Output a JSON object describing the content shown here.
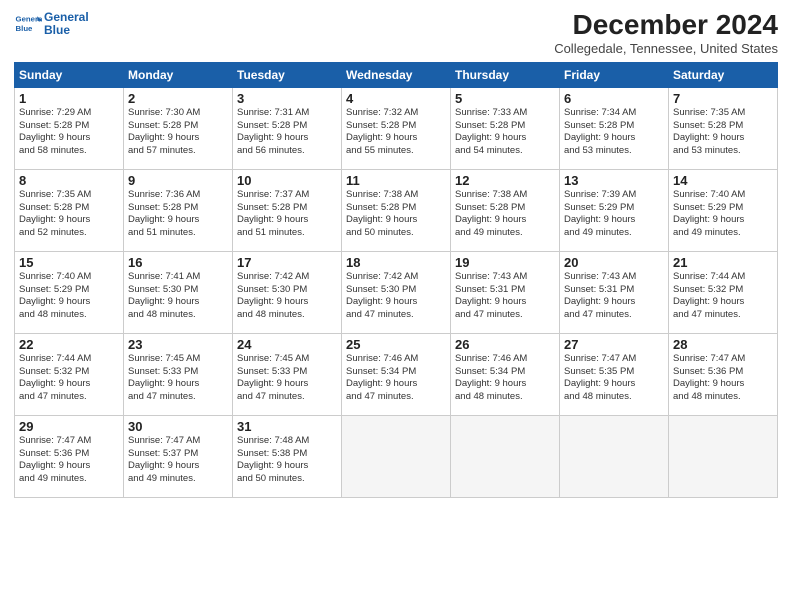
{
  "logo": {
    "line1": "General",
    "line2": "Blue"
  },
  "title": "December 2024",
  "location": "Collegedale, Tennessee, United States",
  "weekdays": [
    "Sunday",
    "Monday",
    "Tuesday",
    "Wednesday",
    "Thursday",
    "Friday",
    "Saturday"
  ],
  "weeks": [
    [
      {
        "day": "1",
        "sunrise": "7:29 AM",
        "sunset": "5:28 PM",
        "daylight": "9 hours and 58 minutes."
      },
      {
        "day": "2",
        "sunrise": "7:30 AM",
        "sunset": "5:28 PM",
        "daylight": "9 hours and 57 minutes."
      },
      {
        "day": "3",
        "sunrise": "7:31 AM",
        "sunset": "5:28 PM",
        "daylight": "9 hours and 56 minutes."
      },
      {
        "day": "4",
        "sunrise": "7:32 AM",
        "sunset": "5:28 PM",
        "daylight": "9 hours and 55 minutes."
      },
      {
        "day": "5",
        "sunrise": "7:33 AM",
        "sunset": "5:28 PM",
        "daylight": "9 hours and 54 minutes."
      },
      {
        "day": "6",
        "sunrise": "7:34 AM",
        "sunset": "5:28 PM",
        "daylight": "9 hours and 53 minutes."
      },
      {
        "day": "7",
        "sunrise": "7:35 AM",
        "sunset": "5:28 PM",
        "daylight": "9 hours and 53 minutes."
      }
    ],
    [
      {
        "day": "8",
        "sunrise": "7:35 AM",
        "sunset": "5:28 PM",
        "daylight": "9 hours and 52 minutes."
      },
      {
        "day": "9",
        "sunrise": "7:36 AM",
        "sunset": "5:28 PM",
        "daylight": "9 hours and 51 minutes."
      },
      {
        "day": "10",
        "sunrise": "7:37 AM",
        "sunset": "5:28 PM",
        "daylight": "9 hours and 51 minutes."
      },
      {
        "day": "11",
        "sunrise": "7:38 AM",
        "sunset": "5:28 PM",
        "daylight": "9 hours and 50 minutes."
      },
      {
        "day": "12",
        "sunrise": "7:38 AM",
        "sunset": "5:28 PM",
        "daylight": "9 hours and 49 minutes."
      },
      {
        "day": "13",
        "sunrise": "7:39 AM",
        "sunset": "5:29 PM",
        "daylight": "9 hours and 49 minutes."
      },
      {
        "day": "14",
        "sunrise": "7:40 AM",
        "sunset": "5:29 PM",
        "daylight": "9 hours and 49 minutes."
      }
    ],
    [
      {
        "day": "15",
        "sunrise": "7:40 AM",
        "sunset": "5:29 PM",
        "daylight": "9 hours and 48 minutes."
      },
      {
        "day": "16",
        "sunrise": "7:41 AM",
        "sunset": "5:30 PM",
        "daylight": "9 hours and 48 minutes."
      },
      {
        "day": "17",
        "sunrise": "7:42 AM",
        "sunset": "5:30 PM",
        "daylight": "9 hours and 48 minutes."
      },
      {
        "day": "18",
        "sunrise": "7:42 AM",
        "sunset": "5:30 PM",
        "daylight": "9 hours and 47 minutes."
      },
      {
        "day": "19",
        "sunrise": "7:43 AM",
        "sunset": "5:31 PM",
        "daylight": "9 hours and 47 minutes."
      },
      {
        "day": "20",
        "sunrise": "7:43 AM",
        "sunset": "5:31 PM",
        "daylight": "9 hours and 47 minutes."
      },
      {
        "day": "21",
        "sunrise": "7:44 AM",
        "sunset": "5:32 PM",
        "daylight": "9 hours and 47 minutes."
      }
    ],
    [
      {
        "day": "22",
        "sunrise": "7:44 AM",
        "sunset": "5:32 PM",
        "daylight": "9 hours and 47 minutes."
      },
      {
        "day": "23",
        "sunrise": "7:45 AM",
        "sunset": "5:33 PM",
        "daylight": "9 hours and 47 minutes."
      },
      {
        "day": "24",
        "sunrise": "7:45 AM",
        "sunset": "5:33 PM",
        "daylight": "9 hours and 47 minutes."
      },
      {
        "day": "25",
        "sunrise": "7:46 AM",
        "sunset": "5:34 PM",
        "daylight": "9 hours and 47 minutes."
      },
      {
        "day": "26",
        "sunrise": "7:46 AM",
        "sunset": "5:34 PM",
        "daylight": "9 hours and 48 minutes."
      },
      {
        "day": "27",
        "sunrise": "7:47 AM",
        "sunset": "5:35 PM",
        "daylight": "9 hours and 48 minutes."
      },
      {
        "day": "28",
        "sunrise": "7:47 AM",
        "sunset": "5:36 PM",
        "daylight": "9 hours and 48 minutes."
      }
    ],
    [
      {
        "day": "29",
        "sunrise": "7:47 AM",
        "sunset": "5:36 PM",
        "daylight": "9 hours and 49 minutes."
      },
      {
        "day": "30",
        "sunrise": "7:47 AM",
        "sunset": "5:37 PM",
        "daylight": "9 hours and 49 minutes."
      },
      {
        "day": "31",
        "sunrise": "7:48 AM",
        "sunset": "5:38 PM",
        "daylight": "9 hours and 50 minutes."
      },
      null,
      null,
      null,
      null
    ]
  ]
}
